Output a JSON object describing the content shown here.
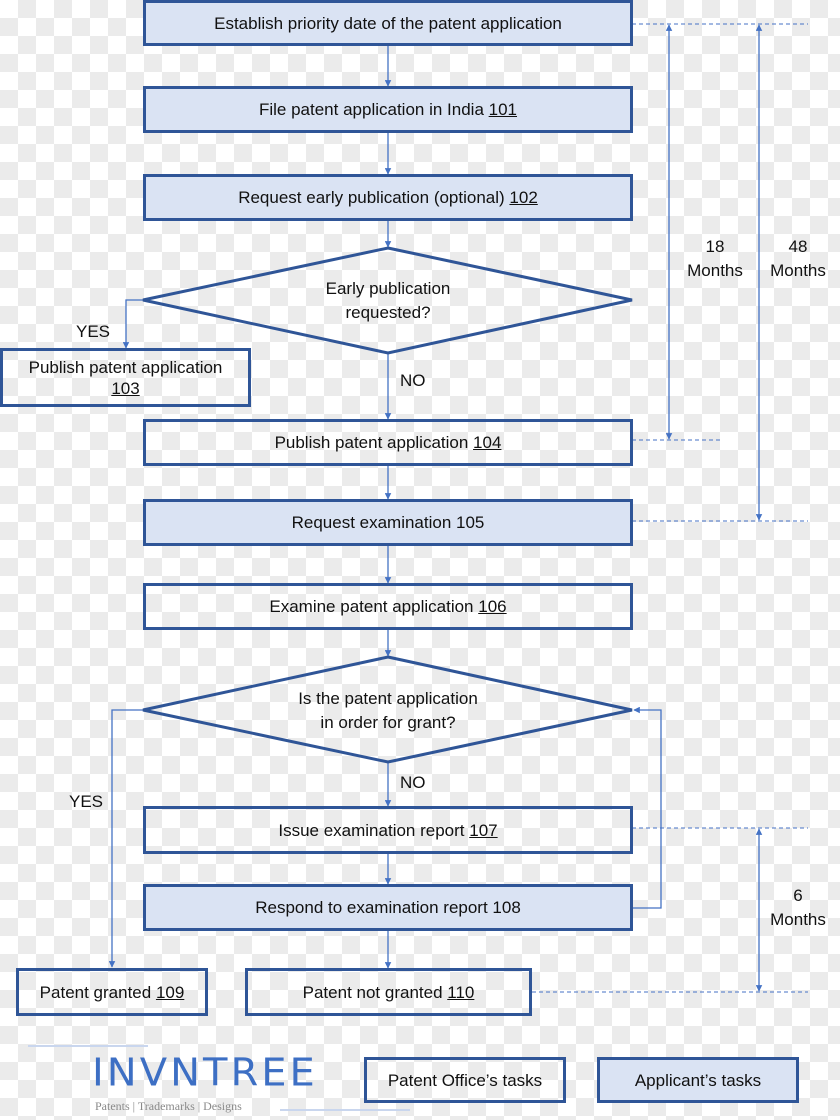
{
  "colors": {
    "box_border": "#2F5597",
    "applicant_fill": "#DAE3F3",
    "connector": "#4472C4",
    "timeline": "#4472C4"
  },
  "steps": {
    "s100": {
      "text": "Establish priority date of the patent application",
      "ref": "",
      "owner": "applicant"
    },
    "s101": {
      "text": "File patent application in India ",
      "ref": "101",
      "owner": "applicant"
    },
    "s102": {
      "text": "Request early publication (optional) ",
      "ref": "102",
      "owner": "applicant"
    },
    "s103": {
      "text": "Publish patent application",
      "ref": "103",
      "owner": "office"
    },
    "s104": {
      "text": "Publish patent application ",
      "ref": "104",
      "owner": "office"
    },
    "s105": {
      "text": "Request examination 105",
      "ref": "",
      "owner": "applicant"
    },
    "s106": {
      "text": "Examine patent application ",
      "ref": "106",
      "owner": "office"
    },
    "s107": {
      "text": "Issue examination report ",
      "ref": "107",
      "owner": "office"
    },
    "s108": {
      "text": "Respond to examination report 108",
      "ref": "",
      "owner": "applicant"
    },
    "s109": {
      "text": "Patent granted ",
      "ref": "109",
      "owner": "office"
    },
    "s110": {
      "text": "Patent not granted ",
      "ref": "110",
      "owner": "office"
    }
  },
  "decisions": {
    "d1": {
      "line1": "Early publication",
      "line2": "requested?",
      "yes": "YES",
      "no": "NO"
    },
    "d2": {
      "line1": "Is the patent application",
      "line2": "in order for grant?",
      "yes": "YES",
      "no": "NO"
    }
  },
  "timelines": {
    "t18": {
      "value": "18",
      "unit": "Months"
    },
    "t48": {
      "value": "48",
      "unit": "Months"
    },
    "t6": {
      "value": "6",
      "unit": "Months"
    }
  },
  "legend": {
    "office": "Patent Office’s tasks",
    "applicant": "Applicant’s tasks"
  },
  "logo": {
    "wordmark": "INVNTREE",
    "tagline": "Patents | Trademarks | Designs"
  }
}
